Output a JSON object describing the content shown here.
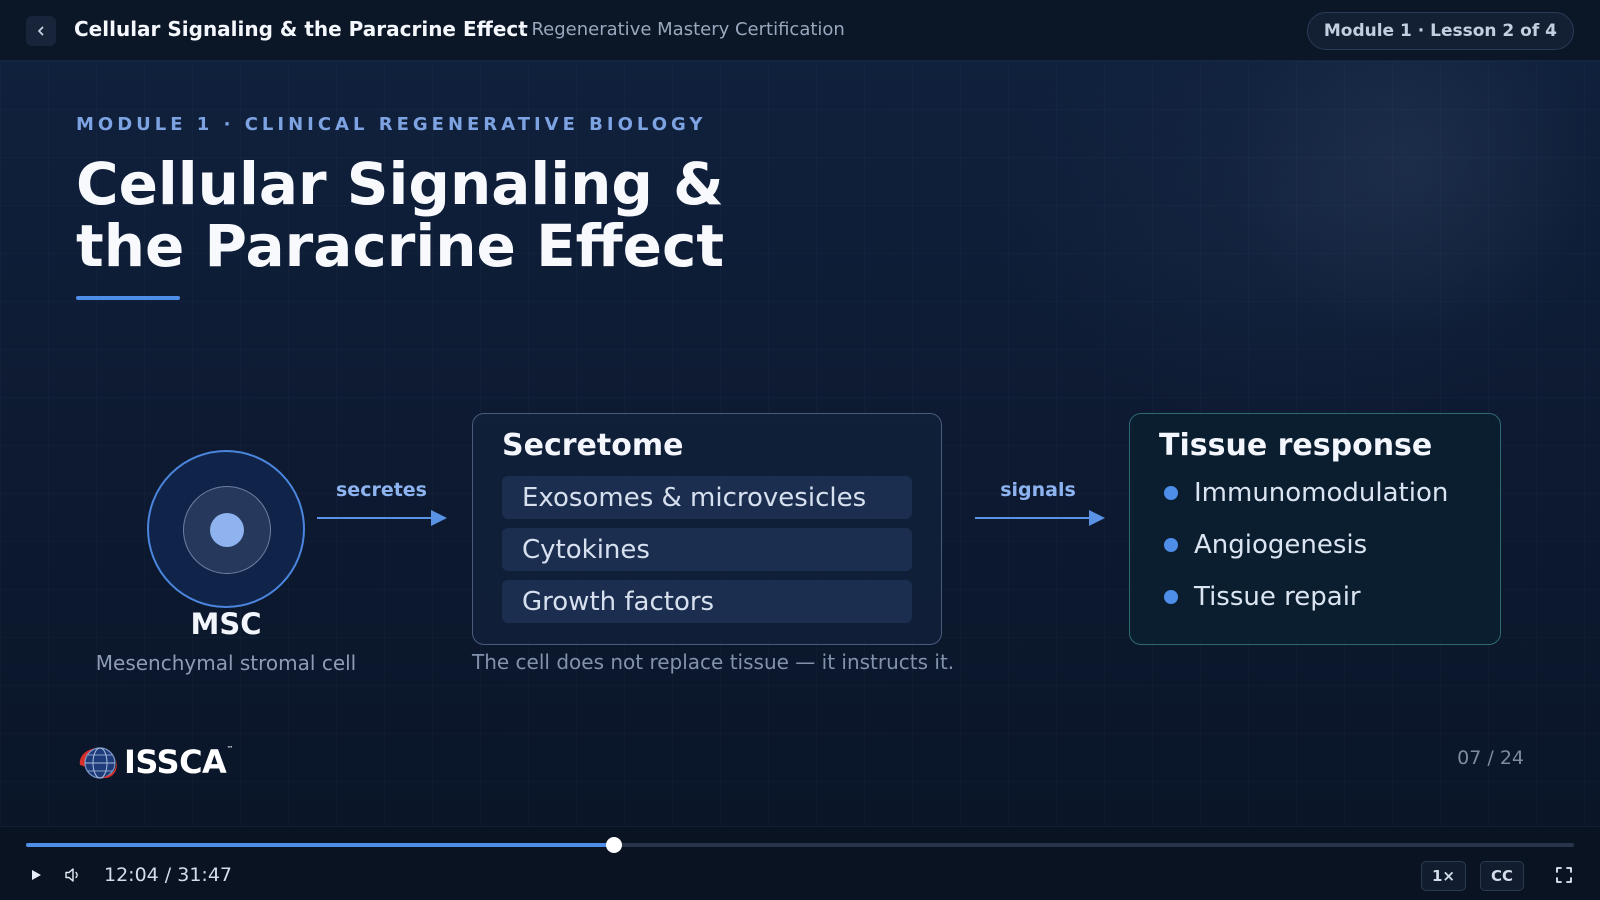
{
  "header": {
    "title": "Cellular Signaling & the Paracrine Effect",
    "subtitle": "· Regenerative Mastery Certification",
    "lesson_pill": "Module 1 · Lesson 2 of 4",
    "back_icon": "chevron-left-icon"
  },
  "slide": {
    "eyebrow": "MODULE 1 · CLINICAL REGENERATIVE BIOLOGY",
    "title_line1": "Cellular Signaling &",
    "title_line2": "the Paracrine Effect",
    "cell": {
      "name": "MSC",
      "description": "Mesenchymal stromal cell"
    },
    "arrow1_label": "secretes",
    "arrow2_label": "signals",
    "secretome": {
      "heading": "Secretome",
      "items": [
        "Exosomes & microvesicles",
        "Cytokines",
        "Growth factors"
      ]
    },
    "tissue": {
      "heading": "Tissue response",
      "items": [
        "Immunomodulation",
        "Angiogenesis",
        "Tissue repair"
      ]
    },
    "caption": "The cell does not replace tissue — it instructs it.",
    "logo_text": "ISSCA",
    "logo_tm": "™",
    "page_count": "07 / 24"
  },
  "player": {
    "current_time": "12:04",
    "total_time": "31:47",
    "time_display": "12:04 / 31:47",
    "progress_fraction": 0.38,
    "speed_label": "1×",
    "cc_label": "CC",
    "icons": [
      "play-icon",
      "volume-icon",
      "fullscreen-icon"
    ]
  },
  "colors": {
    "accent": "#4f8ee8",
    "background": "#0a1426",
    "tissue_border": "#2f6a73"
  }
}
